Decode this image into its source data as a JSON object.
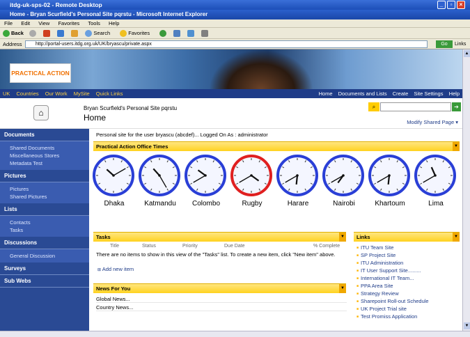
{
  "remote": {
    "title": "itdg-uk-sps-02 - Remote Desktop"
  },
  "browser": {
    "title": "Home - Bryan Scurfield's Personal Site pqrstu - Microsoft Internet Explorer",
    "menu": [
      "File",
      "Edit",
      "View",
      "Favorites",
      "Tools",
      "Help"
    ],
    "toolbar": {
      "back": "Back",
      "search": "Search",
      "favorites": "Favorites"
    },
    "address_label": "Address",
    "address": "http://portal-users.itdg.org.uk/UK/bryascu/private.aspx",
    "go": "Go",
    "links": "Links"
  },
  "banner": {
    "logo": "PRACTICAL ACTION"
  },
  "topnav": {
    "left": [
      "UK",
      "Countries",
      "Our Work",
      "MySite",
      "Quick Links"
    ],
    "right": [
      "Home",
      "Documents and Lists",
      "Create",
      "Site Settings",
      "Help"
    ]
  },
  "header": {
    "site_name": "Bryan Scurfield's Personal Site pqrstu",
    "page_title": "Home",
    "modify": "Modify Shared Page ▾"
  },
  "sidebar": [
    {
      "heading": "Documents",
      "items": [
        "Shared Documents",
        "Miscellaneous Stores",
        "Metadata Test"
      ]
    },
    {
      "heading": "Pictures",
      "items": [
        "Pictures",
        "Shared Pictures"
      ]
    },
    {
      "heading": "Lists",
      "items": [
        "Contacts",
        "Tasks"
      ]
    },
    {
      "heading": "Discussions",
      "items": [
        "General Discussion"
      ]
    },
    {
      "heading": "Surveys",
      "items": []
    },
    {
      "heading": "Sub Webs",
      "items": []
    }
  ],
  "main": {
    "userline": "Personal site for the user bryascu (abcdef)... Logged On As : administrator",
    "times_title": "Practical Action Office Times",
    "clocks": [
      {
        "city": "Dhaka",
        "hour": 10.4,
        "minute": 10,
        "ring": "#2a3fd6"
      },
      {
        "city": "Katmandu",
        "hour": 10.6,
        "minute": 25,
        "ring": "#2a3fd6"
      },
      {
        "city": "Colombo",
        "hour": 10.2,
        "minute": 40,
        "ring": "#2a3fd6"
      },
      {
        "city": "Rugby",
        "hour": 4.2,
        "minute": 40,
        "ring": "#e02020"
      },
      {
        "city": "Harare",
        "hour": 6.2,
        "minute": 40,
        "ring": "#2a3fd6"
      },
      {
        "city": "Nairobi",
        "hour": 7.2,
        "minute": 40,
        "ring": "#2a3fd6"
      },
      {
        "city": "Khartoum",
        "hour": 6.2,
        "minute": 40,
        "ring": "#2a3fd6"
      },
      {
        "city": "Lima",
        "hour": 11.2,
        "minute": 40,
        "ring": "#2a3fd6"
      }
    ],
    "tasks": {
      "title": "Tasks",
      "columns": [
        "Title",
        "Status",
        "Priority",
        "Due Date",
        "% Complete"
      ],
      "empty": "There are no items to show in this view of the \"Tasks\" list. To create a new item, click \"New item\" above.",
      "add": "Add new item"
    },
    "news": {
      "title": "News For You",
      "items": [
        "Global News...",
        "Country News..."
      ]
    },
    "links": {
      "title": "Links",
      "items": [
        "ITU Team Site",
        "SP Project Site",
        "ITU Administration",
        "IT User Support Site.........",
        "International IT Team...",
        "PPA Area Site",
        "Strategy Review",
        "Sharepoint Roll-out Schedule",
        "UK Project Trial site",
        "Test Promiss Application"
      ]
    }
  }
}
